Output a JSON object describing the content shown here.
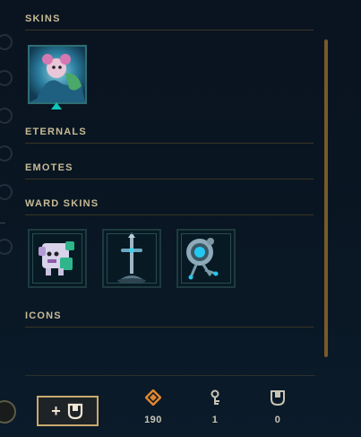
{
  "sections": {
    "skins": "SKINS",
    "eternals": "ETERNALS",
    "emotes": "EMOTES",
    "ward_skins": "WARD SKINS",
    "icons": "ICONS"
  },
  "skins": [
    {
      "name": "champion-skin-portrait",
      "icon": "champion-portrait-icon"
    }
  ],
  "ward_skins": [
    {
      "icon": "poro-ward-icon"
    },
    {
      "icon": "sword-ward-icon"
    },
    {
      "icon": "robot-ward-icon"
    }
  ],
  "footer": {
    "add_button_label": "+",
    "currencies": [
      {
        "icon": "orange-essence-icon",
        "value": "190",
        "color": "#e0862d"
      },
      {
        "icon": "key-icon",
        "value": "1",
        "color": "#c8c4b4"
      },
      {
        "icon": "chest-icon",
        "value": "0",
        "color": "#c8c4b4"
      }
    ]
  },
  "colors": {
    "header_text": "#c8bb95",
    "gold_accent": "#c8aa6e",
    "scrollbar": "#785a28",
    "tile_border": "#1e3a3e"
  }
}
